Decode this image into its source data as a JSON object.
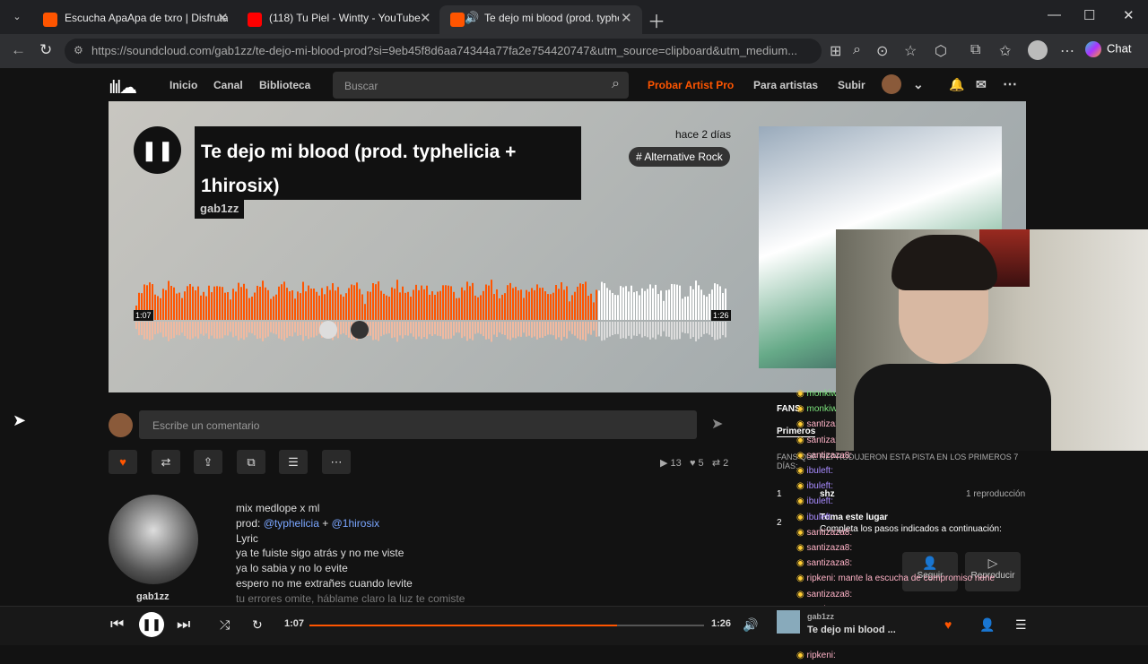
{
  "browser": {
    "tabs": [
      {
        "title": "Escucha ApaApa de txro | Disfruta",
        "color": "#ff5500"
      },
      {
        "title": "(118) Tu Piel - Wintty - YouTube",
        "color": "#ff0000"
      },
      {
        "title": "Te dejo mi blood (prod. typhe",
        "color": "#ff5500"
      }
    ],
    "url": "https://soundcloud.com/gab1zz/te-dejo-mi-blood-prod?si=9eb45f8d6aa74344a77fa2e754420747&utm_source=clipboard&utm_medium...",
    "chat_label": "Chat"
  },
  "nav": {
    "links": [
      "Inicio",
      "Canal",
      "Biblioteca"
    ],
    "search_placeholder": "Buscar",
    "pro": "Probar Artist Pro",
    "artists": "Para artistas",
    "upload": "Subir"
  },
  "track": {
    "title": "Te dejo mi blood (prod. typhelicia + 1hirosix)",
    "artist": "gab1zz",
    "ago": "hace 2 días",
    "genre": "# Alternative Rock",
    "elapsed": "1:07",
    "duration": "1:26",
    "progress": 0.78
  },
  "comment": {
    "placeholder": "Escribe un comentario"
  },
  "stats": {
    "plays": "13",
    "likes": "5",
    "reposts": "2"
  },
  "desc": {
    "l1": "mix medlope x ml",
    "prod": "prod: ",
    "m1": "@typhelicia",
    "plus": " + ",
    "m2": "@1hirosix",
    "lines": [
      "Lyric",
      "ya te fuiste sigo atrás y no me viste",
      "ya lo sabia y no lo evite",
      "espero no me extrañes cuando levite",
      "tu errores omite, háblame claro la luz te comiste"
    ]
  },
  "artist_name": "gab1zz",
  "fans": {
    "title": "FANS",
    "first": "Primeros",
    "note": "FANS QUE REPRODUJERON ESTA PISTA EN LOS PRIMEROS 7 DÍAS:",
    "rank1": "1",
    "fan1": "shz",
    "plays1": "1 reproducción",
    "rank2": "2",
    "take": "Toma este lugar",
    "steps": "Completa los pasos indicados a continuación:",
    "follow": "Seguir",
    "play": "Reproducir"
  },
  "chat": [
    {
      "u": "monkiwi0:",
      "c": "u3"
    },
    {
      "u": "monkiwi0:",
      "c": "u3"
    },
    {
      "u": "santizaza8:",
      "c": "u1"
    },
    {
      "u": "santizaza8:",
      "c": "u1"
    },
    {
      "u": "santizaza8:",
      "c": "u1"
    },
    {
      "u": "ibuleft:",
      "c": "u2"
    },
    {
      "u": "ibuleft:",
      "c": "u2"
    },
    {
      "u": "ibuleft:",
      "c": "u2"
    },
    {
      "u": "ibuleft:",
      "c": "u2"
    },
    {
      "u": "santizaza8:",
      "c": "u1"
    },
    {
      "u": "santizaza8:",
      "c": "u1"
    },
    {
      "u": "santizaza8:",
      "c": "u1"
    },
    {
      "u": "ripkeni: mante la escucha de compromiso nene",
      "c": "u1"
    },
    {
      "u": "santizaza8:",
      "c": "u1"
    },
    {
      "u": "santizaza8:",
      "c": "u1"
    },
    {
      "u": "gab1zz",
      "c": "u1"
    },
    {
      "u": "santizaza8:",
      "c": "u1"
    },
    {
      "u": "ripkeni:",
      "c": "u1"
    }
  ],
  "player": {
    "elapsed": "1:07",
    "duration": "1:26",
    "progress": 0.78,
    "now_title": "Te dejo mi blood ..."
  }
}
